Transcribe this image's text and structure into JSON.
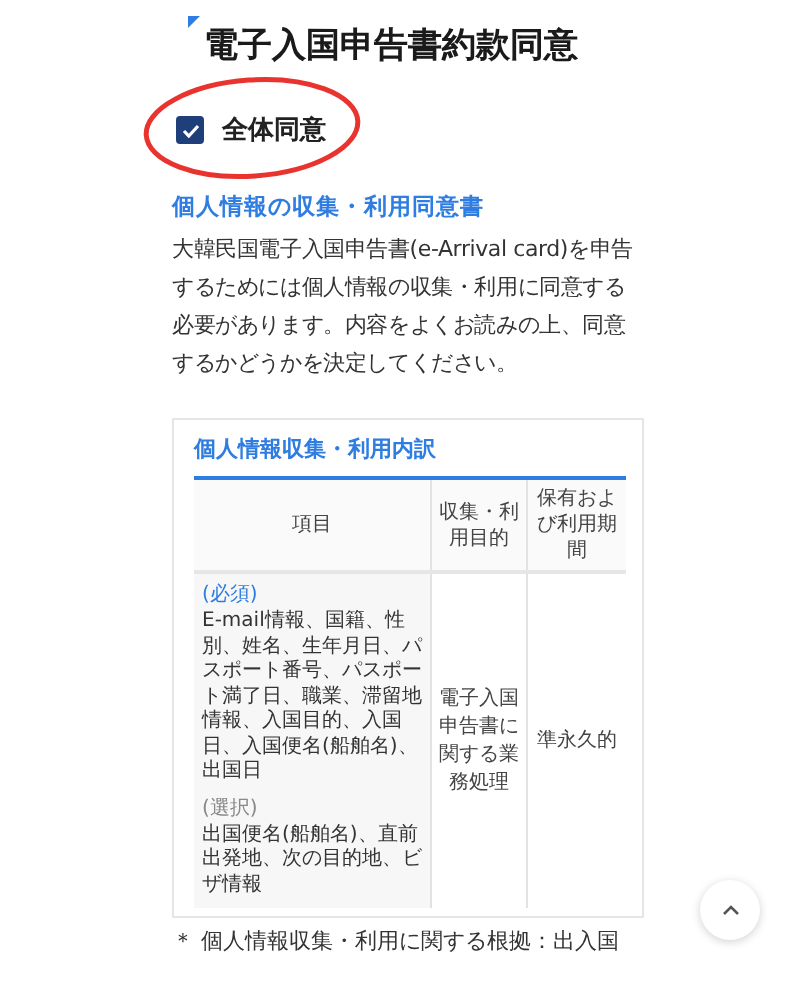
{
  "page_title": "電子入国申告書約款同意",
  "agree_all": {
    "label": "全体同意",
    "checked": true
  },
  "consent_section": {
    "heading": "個人情報の収集・利用同意書",
    "intro": "大韓民国電子入国申告書(e-Arrival card)を申告するためには個人情報の収集・利用に同意する必要があります。内容をよくお読みの上、同意するかどうかを決定してください。"
  },
  "usage_card": {
    "heading": "個人情報収集・利用内訳",
    "table": {
      "columns": [
        "項目",
        "収集・利用目的",
        "保有および利用期間"
      ],
      "rows": [
        {
          "items": [
            {
              "tag": "(必須)",
              "kind": "required",
              "text": "E-mail情報、国籍、性別、姓名、生年月日、パスポート番号、パスポート満了日、職業、滞留地情報、入国目的、入国日、入国便名(船舶名)、出国日"
            },
            {
              "tag": "(選択)",
              "kind": "optional",
              "text": "出国便名(船舶名)、直前出発地、次の目的地、ビザ情報"
            }
          ],
          "purpose": "電子入国申告書に関する業務処理",
          "period": "準永久的"
        }
      ]
    },
    "footnote": "＊ 個人情報収集・利用に関する根拠：出入国"
  }
}
